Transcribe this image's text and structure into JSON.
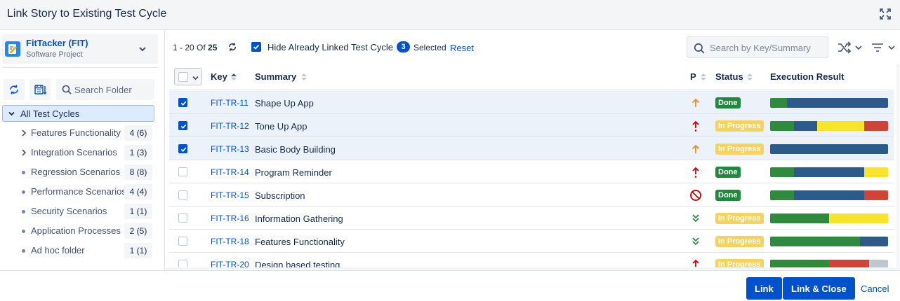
{
  "dialog": {
    "title": "Link Story to Existing Test Cycle"
  },
  "project": {
    "name": "FitTacker (FIT)",
    "type": "Software Project"
  },
  "sidebar": {
    "search_placeholder": "Search Folder",
    "root_label": "All Test Cycles",
    "folders": [
      {
        "label": "Features Functionality",
        "count": "4 (6)",
        "expandable": true
      },
      {
        "label": "Integration Scenarios",
        "count": "1 (3)",
        "expandable": true
      },
      {
        "label": "Regression Scenarios",
        "count": "8 (8)",
        "expandable": false
      },
      {
        "label": "Performance Scenarios",
        "count": "4 (4)",
        "expandable": false
      },
      {
        "label": "Security Scenarios",
        "count": "1 (1)",
        "expandable": false
      },
      {
        "label": "Application Processes",
        "count": "2 (5)",
        "expandable": false
      },
      {
        "label": "Ad hoc folder",
        "count": "1 (1)",
        "expandable": false
      }
    ]
  },
  "toolbar": {
    "range": "1 - 20",
    "of_label": "Of",
    "total": "25",
    "hide_linked_label": "Hide Already Linked Test Cycle",
    "selected_count": "3",
    "selected_label": "Selected",
    "reset_label": "Reset",
    "search_placeholder": "Search by Key/Summary"
  },
  "table": {
    "headers": {
      "key": "Key",
      "summary": "Summary",
      "priority": "P",
      "status": "Status",
      "execution": "Execution Result"
    },
    "rows": [
      {
        "key": "FIT-TR-11",
        "summary": "Shape Up App",
        "priority": "medium",
        "status": "Done",
        "checked": true,
        "execution": [
          {
            "color": "#2e8b3e",
            "pct": 14
          },
          {
            "color": "#2c5a8a",
            "pct": 86
          }
        ]
      },
      {
        "key": "FIT-TR-12",
        "summary": "Tone Up App",
        "priority": "highest",
        "status": "In Progress",
        "checked": true,
        "execution": [
          {
            "color": "#2e8b3e",
            "pct": 20
          },
          {
            "color": "#2c5a8a",
            "pct": 20
          },
          {
            "color": "#f7e42b",
            "pct": 40
          },
          {
            "color": "#d04437",
            "pct": 20
          }
        ]
      },
      {
        "key": "FIT-TR-13",
        "summary": "Basic Body Building",
        "priority": "medium",
        "status": "In Progress",
        "checked": true,
        "execution": [
          {
            "color": "#2c5a8a",
            "pct": 100
          }
        ]
      },
      {
        "key": "FIT-TR-14",
        "summary": "Program Reminder",
        "priority": "highest",
        "status": "Done",
        "checked": false,
        "execution": [
          {
            "color": "#2e8b3e",
            "pct": 20
          },
          {
            "color": "#2c5a8a",
            "pct": 60
          },
          {
            "color": "#f7e42b",
            "pct": 20
          }
        ]
      },
      {
        "key": "FIT-TR-15",
        "summary": "Subscription",
        "priority": "blocker",
        "status": "Done",
        "checked": false,
        "execution": [
          {
            "color": "#2e8b3e",
            "pct": 20
          },
          {
            "color": "#2c5a8a",
            "pct": 60
          },
          {
            "color": "#d04437",
            "pct": 20
          }
        ]
      },
      {
        "key": "FIT-TR-16",
        "summary": "Information Gathering",
        "priority": "lowest",
        "status": "In Progress",
        "checked": false,
        "execution": [
          {
            "color": "#2e8b3e",
            "pct": 50
          },
          {
            "color": "#f7e42b",
            "pct": 50
          }
        ]
      },
      {
        "key": "FIT-TR-18",
        "summary": "Features Functionality",
        "priority": "lowest",
        "status": "In Progress",
        "checked": false,
        "execution": [
          {
            "color": "#2e8b3e",
            "pct": 76
          },
          {
            "color": "#2c5a8a",
            "pct": 24
          }
        ]
      },
      {
        "key": "FIT-TR-20",
        "summary": "Design based testing",
        "priority": "highest",
        "status": "In Progress",
        "checked": false,
        "execution": [
          {
            "color": "#2e8b3e",
            "pct": 50
          },
          {
            "color": "#d04437",
            "pct": 34
          },
          {
            "color": "#c1c7d0",
            "pct": 16
          }
        ]
      }
    ]
  },
  "footer": {
    "link_label": "Link",
    "link_close_label": "Link & Close",
    "cancel_label": "Cancel"
  },
  "colors": {
    "primary": "#0052cc",
    "done": "#1f8a3c",
    "in_progress": "#f7d35c"
  }
}
